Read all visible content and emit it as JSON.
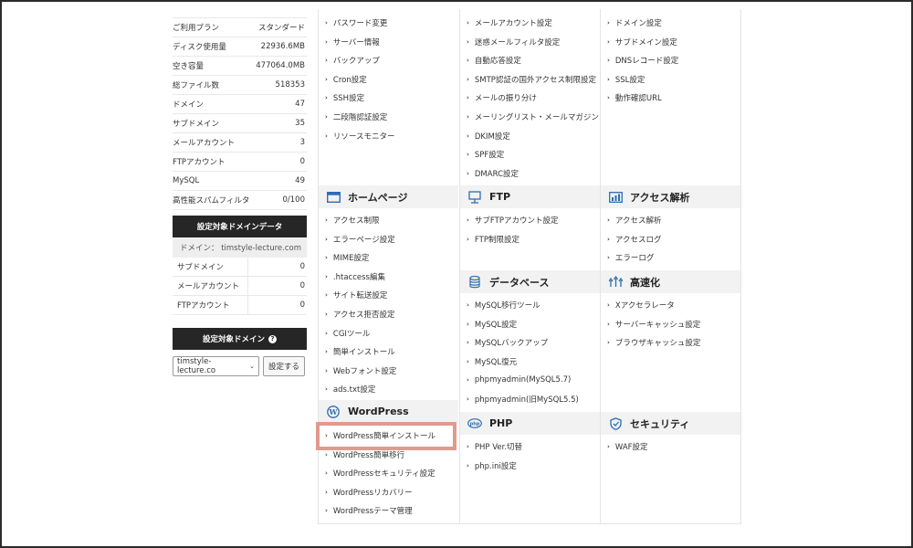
{
  "sidebar": {
    "stats": [
      {
        "label": "ご利用プラン",
        "value": "スタンダード"
      },
      {
        "label": "ディスク使用量",
        "value": "22936.6MB"
      },
      {
        "label": "空き容量",
        "value": "477064.0MB"
      },
      {
        "label": "総ファイル数",
        "value": "518353"
      },
      {
        "label": "ドメイン",
        "value": "47"
      },
      {
        "label": "サブドメイン",
        "value": "35"
      },
      {
        "label": "メールアカウント",
        "value": "3"
      },
      {
        "label": "FTPアカウント",
        "value": "0"
      },
      {
        "label": "MySQL",
        "value": "49"
      },
      {
        "label": "高性能スパムフィルタ",
        "value": "0/100"
      }
    ],
    "domain_data_title": "設定対象ドメインデータ",
    "domain_line": "ドメイン： timstyle-lecture.com",
    "domain_stats": [
      {
        "label": "サブドメイン",
        "value": "0"
      },
      {
        "label": "メールアカウント",
        "value": "0"
      },
      {
        "label": "FTPアカウント",
        "value": "0"
      }
    ],
    "target_domain_title": "設定対象ドメイン",
    "select_value": "timstyle-lecture.co",
    "set_button": "設定する"
  },
  "menu": {
    "col1_top": [
      "パスワード変更",
      "サーバー情報",
      "バックアップ",
      "Cron設定",
      "SSH設定",
      "二段階認証設定",
      "リソースモニター"
    ],
    "col2_top": [
      "メールアカウント設定",
      "迷惑メールフィルタ設定",
      "自動応答設定",
      "SMTP認証の国外アクセス制限設定",
      "メールの振り分け",
      "メーリングリスト・メールマガジン",
      "DKIM設定",
      "SPF設定",
      "DMARC設定"
    ],
    "col3_top": [
      "ドメイン設定",
      "サブドメイン設定",
      "DNSレコード設定",
      "SSL設定",
      "動作確認URL"
    ],
    "homepage": {
      "title": "ホームページ",
      "items": [
        "アクセス制限",
        "エラーページ設定",
        "MIME設定",
        ".htaccess編集",
        "サイト転送設定",
        "アクセス拒否設定",
        "CGIツール",
        "簡単インストール",
        "Webフォント設定",
        "ads.txt設定"
      ]
    },
    "wordpress": {
      "title": "WordPress",
      "items": [
        "WordPress簡単インストール",
        "WordPress簡単移行",
        "WordPressセキュリティ設定",
        "WordPressリカバリー",
        "WordPressテーマ管理"
      ]
    },
    "ftp": {
      "title": "FTP",
      "items": [
        "サブFTPアカウント設定",
        "FTP制限設定"
      ]
    },
    "database": {
      "title": "データベース",
      "items": [
        "MySQL移行ツール",
        "MySQL設定",
        "MySQLバックアップ",
        "MySQL復元",
        "phpmyadmin(MySQL5.7)",
        "phpmyadmin(旧MySQL5.5)"
      ]
    },
    "php": {
      "title": "PHP",
      "items": [
        "PHP Ver.切替",
        "php.ini設定"
      ]
    },
    "access": {
      "title": "アクセス解析",
      "items": [
        "アクセス解析",
        "アクセスログ",
        "エラーログ"
      ]
    },
    "speed": {
      "title": "高速化",
      "items": [
        "Xアクセラレータ",
        "サーバーキャッシュ設定",
        "ブラウザキャッシュ設定"
      ]
    },
    "security": {
      "title": "セキュリティ",
      "items": [
        "WAF設定"
      ]
    }
  },
  "colors": {
    "highlight": "#e09a8e",
    "section_bg": "#f2f2f2",
    "dark_header": "#262626"
  }
}
